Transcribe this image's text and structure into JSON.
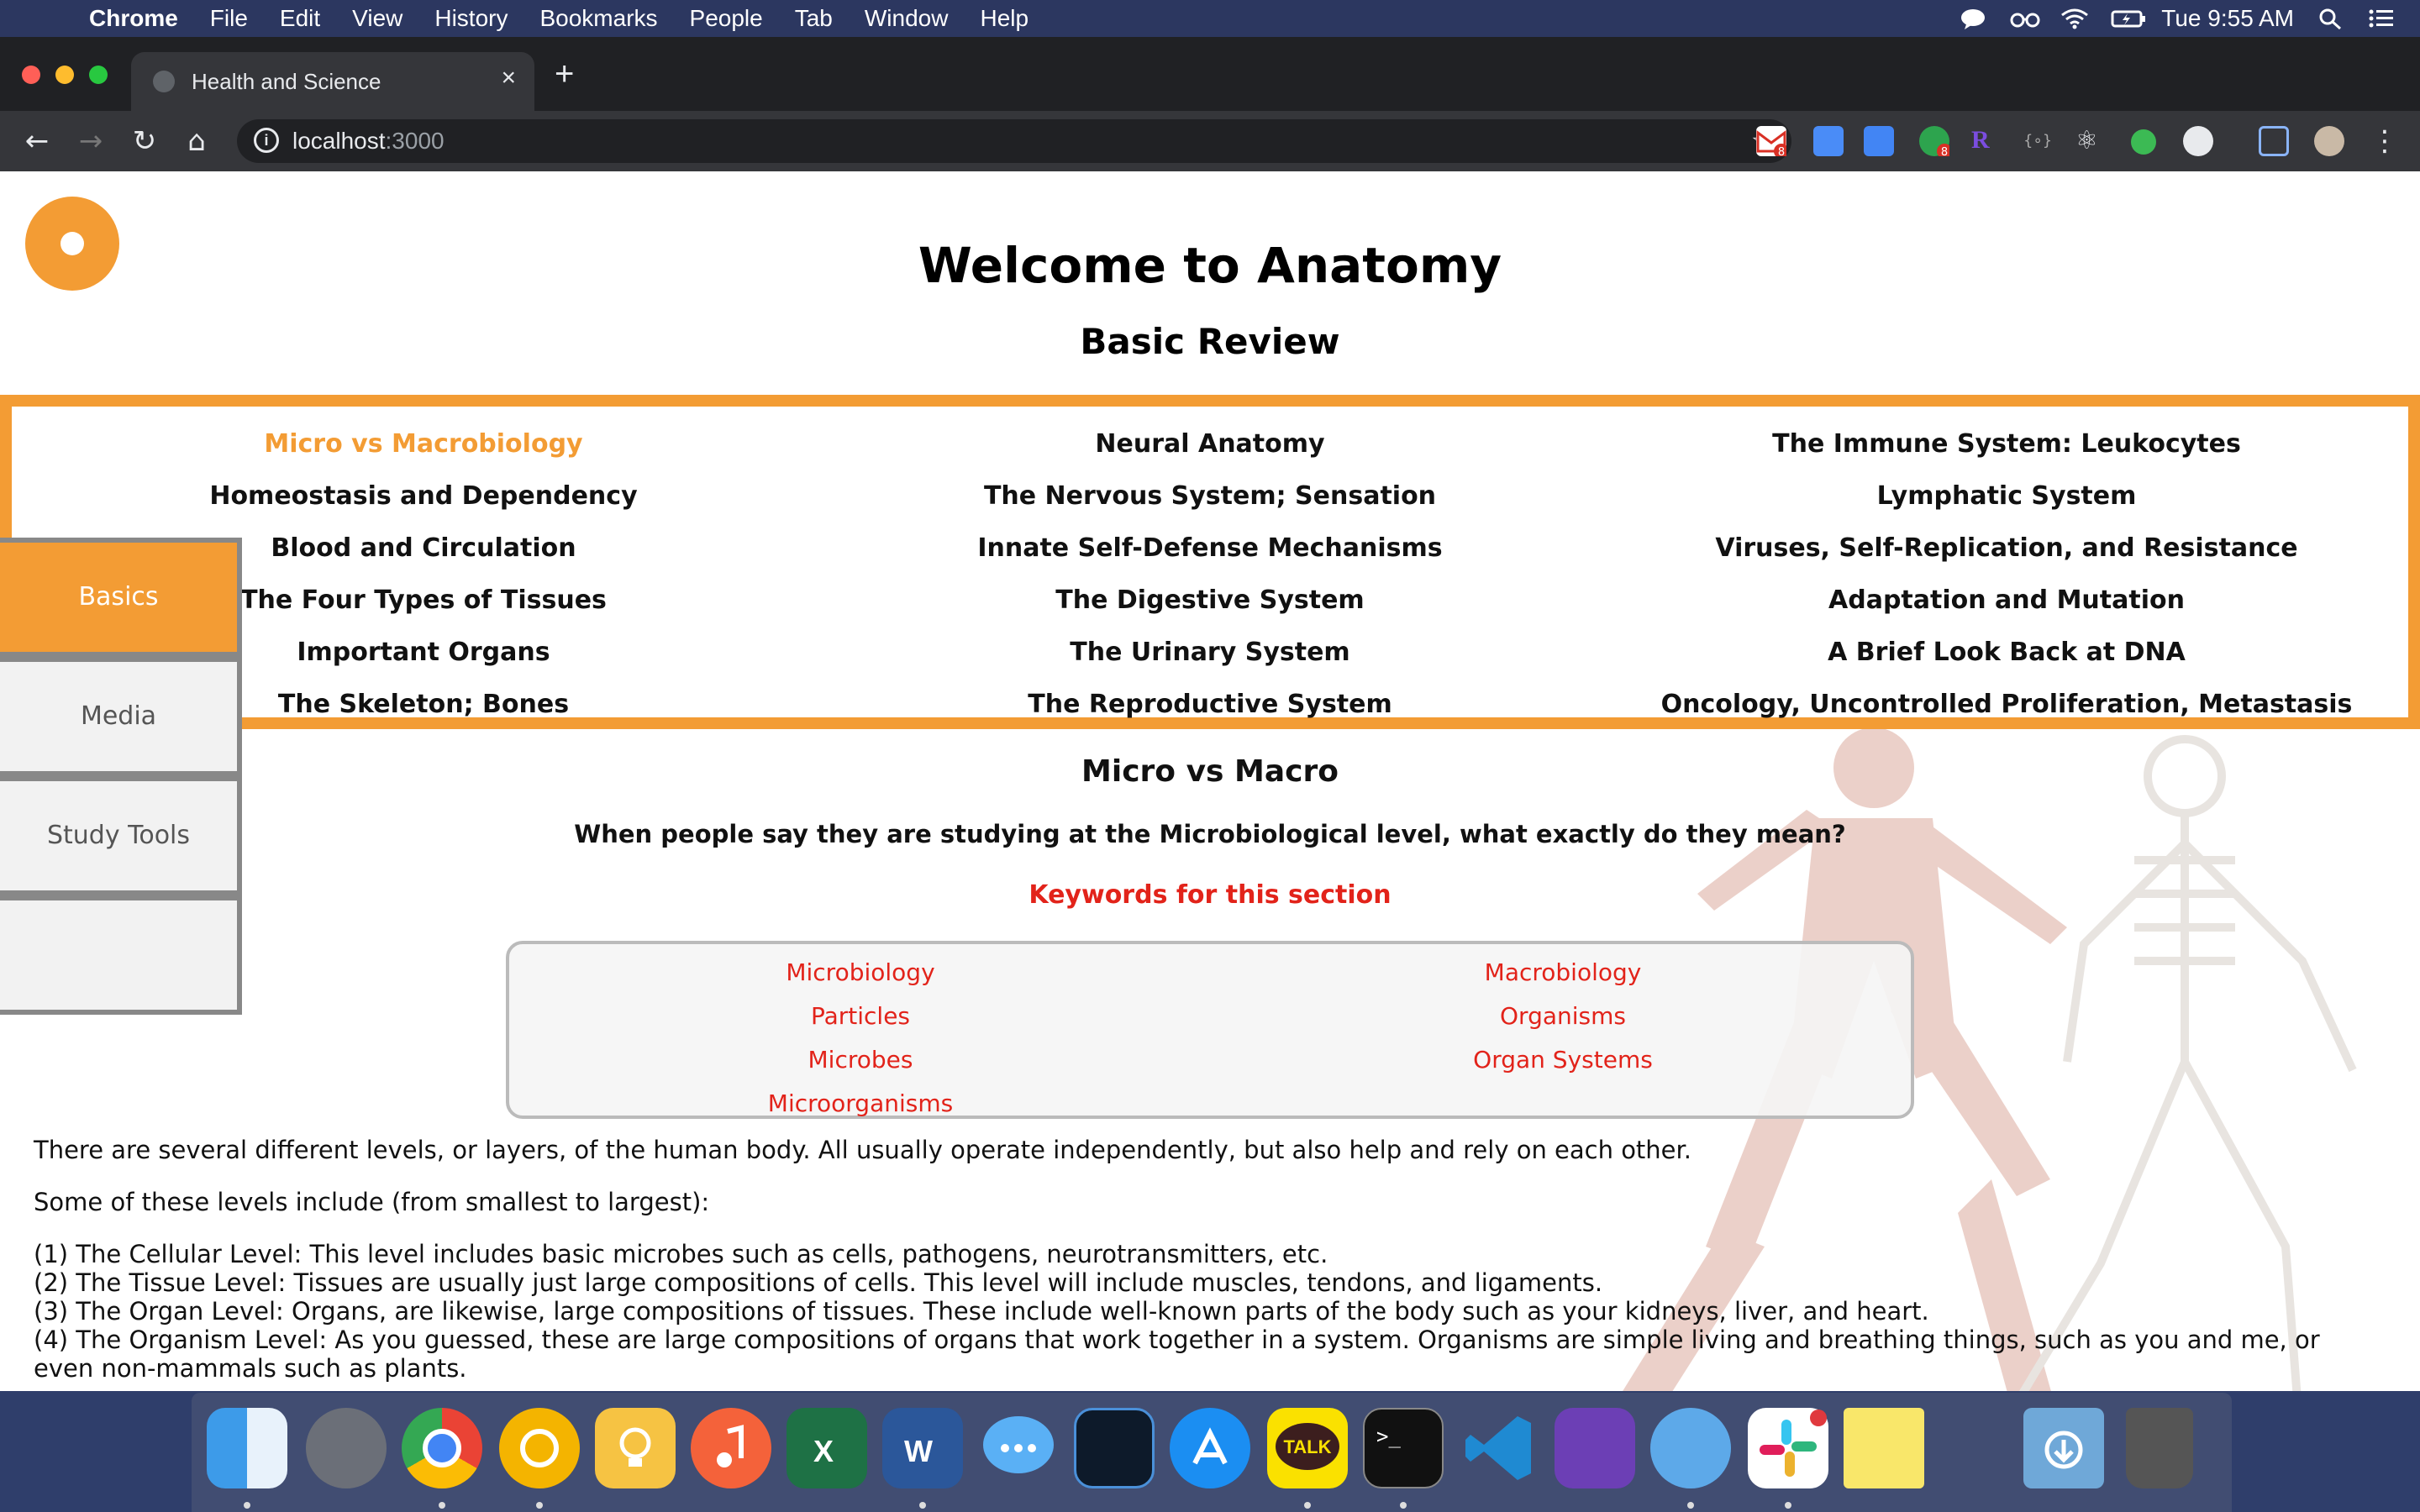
{
  "menubar": {
    "app": "Chrome",
    "items": [
      "File",
      "Edit",
      "View",
      "History",
      "Bookmarks",
      "People",
      "Tab",
      "Window",
      "Help"
    ],
    "clock": "Tue 9:55 AM"
  },
  "browser": {
    "tab_title": "Health and Science",
    "url_host": "localhost",
    "url_port": ":3000",
    "extension_badges": [
      "8",
      "8"
    ]
  },
  "page": {
    "title": "Welcome to Anatomy",
    "subtitle": "Basic Review",
    "topics": {
      "col1": [
        "Micro vs Macrobiology",
        "Homeostasis and Dependency",
        "Blood and Circulation",
        "The Four Types of Tissues",
        "Important Organs",
        "The Skeleton; Bones"
      ],
      "col2": [
        "Neural Anatomy",
        "The Nervous System; Sensation",
        "Innate Self-Defense Mechanisms",
        "The Digestive System",
        "The Urinary System",
        "The Reproductive System"
      ],
      "col3": [
        "The Immune System: Leukocytes",
        "Lymphatic System",
        "Viruses, Self-Replication, and Resistance",
        "Adaptation and Mutation",
        "A Brief Look Back at DNA",
        "Oncology, Uncontrolled Proliferation, Metastasis"
      ],
      "active": "Micro vs Macrobiology"
    },
    "sidenav": [
      "Basics",
      "Media",
      "Study Tools",
      ""
    ],
    "section_title": "Micro vs Macro",
    "question": "When people say they are studying at the Microbiological level, what exactly do they mean?",
    "keywords_heading": "Keywords for this section",
    "keywords": {
      "left": [
        "Microbiology",
        "Particles",
        "Microbes",
        "Microorganisms"
      ],
      "right": [
        "Macrobiology",
        "Organisms",
        "Organ Systems"
      ]
    },
    "body": {
      "p1": "There are several different levels, or layers, of the human body. All usually operate independently, but also help and rely on each other.",
      "p2": "Some of these levels include (from smallest to largest):",
      "levels": [
        "(1) The Cellular Level: This level includes basic microbes such as cells, pathogens, neurotransmitters, etc.",
        "(2) The Tissue Level: Tissues are usually just large compositions of cells. This level will include muscles, tendons, and ligaments.",
        "(3) The Organ Level: Organs, are likewise, large compositions of tissues. These include well-known parts of the body such as your kidneys, liver, and heart.",
        "(4) The Organism Level: As you guessed, these are large compositions of organs that work together in a system. Organisms are simple living and breathing things, such as you and me, or even non-mammals such as plants."
      ]
    }
  },
  "colors": {
    "accent": "#f39c34",
    "keyword": "#e2231a"
  },
  "dock_icons": [
    "finder-icon",
    "launchpad-icon",
    "chrome-icon",
    "chrome-canary-icon",
    "keep-icon",
    "music-icon",
    "excel-icon",
    "word-icon",
    "messages-icon",
    "kindle-icon",
    "app-store-icon",
    "kakaotalk-icon",
    "terminal-icon",
    "vscode-icon",
    "visual-studio-icon",
    "tableplus-icon",
    "slack-icon",
    "stickies-icon",
    "downloads-icon",
    "trash-icon"
  ],
  "dock_labels": {
    "kakaotalk": "TALK",
    "terminal": ">_"
  }
}
